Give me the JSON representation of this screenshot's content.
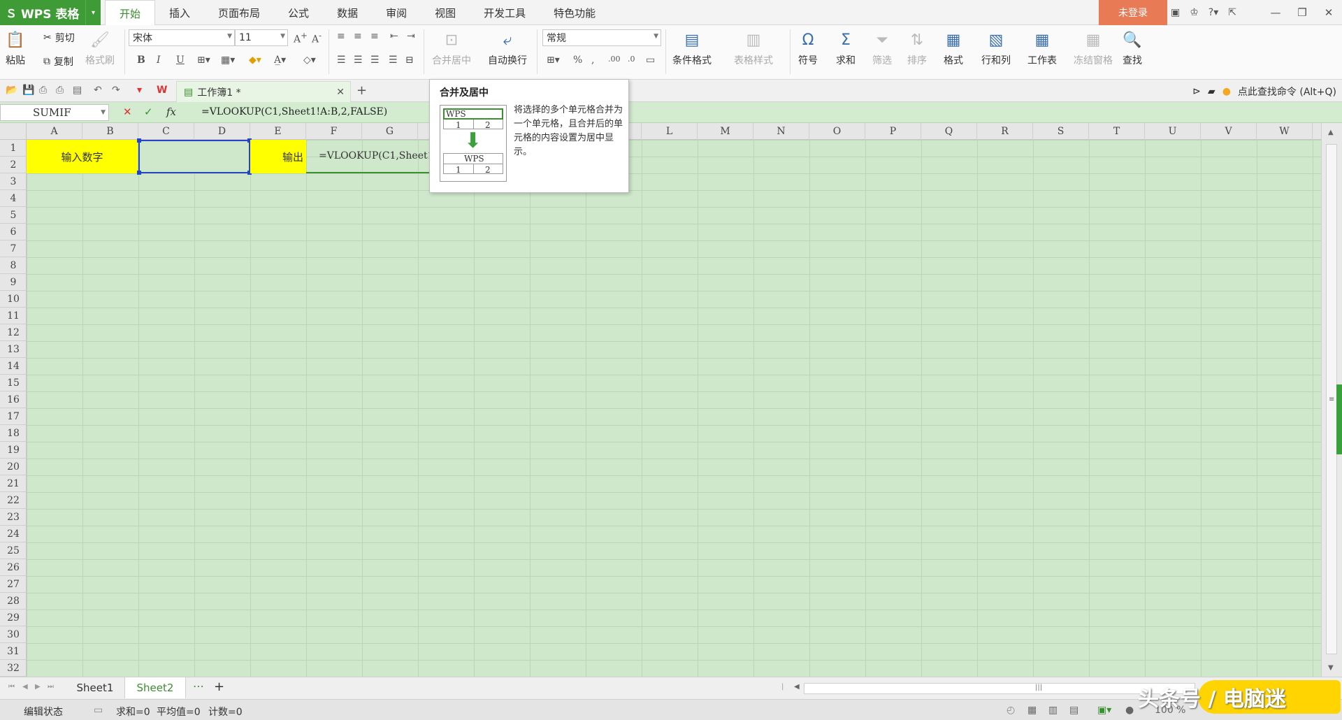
{
  "app": {
    "name": "WPS 表格",
    "login": "未登录"
  },
  "menu_tabs": [
    "开始",
    "插入",
    "页面布局",
    "公式",
    "数据",
    "审阅",
    "视图",
    "开发工具",
    "特色功能"
  ],
  "ribbon": {
    "paste": "粘贴",
    "cut": "剪切",
    "copy": "复制",
    "format_painter": "格式刷",
    "font_name": "宋体",
    "font_size": "11",
    "bold": "B",
    "italic": "I",
    "underline": "U",
    "merge_center": "合并居中",
    "wrap_text": "自动换行",
    "number_format": "常规",
    "percent": "%",
    "cond_format": "条件格式",
    "table_style": "表格样式",
    "symbol": "符号",
    "sum": "求和",
    "filter": "筛选",
    "sort": "排序",
    "format": "格式",
    "rows_cols": "行和列",
    "worksheet": "工作表",
    "freeze": "冻结窗格",
    "find": "查找"
  },
  "doc_tab": {
    "title": "工作簿1 *"
  },
  "command_search": "点此查找命令 (Alt+Q)",
  "formula_bar": {
    "name_box": "SUMIF",
    "cancel": "✕",
    "confirm": "✓",
    "fx": "fx",
    "formula": "=VLOOKUP(C1,Sheet1!A:B,2,FALSE)"
  },
  "columns": [
    "A",
    "B",
    "C",
    "D",
    "E",
    "F",
    "G",
    "H",
    "I",
    "J",
    "K",
    "L",
    "M",
    "N",
    "O",
    "P",
    "Q",
    "R",
    "S",
    "T",
    "U",
    "V",
    "W"
  ],
  "rows": [
    "1",
    "2",
    "3",
    "4",
    "5",
    "6",
    "7",
    "8",
    "9",
    "10",
    "11",
    "12",
    "13",
    "14",
    "15",
    "16",
    "17",
    "18",
    "19",
    "20",
    "21",
    "22",
    "23",
    "24",
    "25",
    "26",
    "27",
    "28",
    "29",
    "30",
    "31",
    "32"
  ],
  "cells": {
    "a1": "输入数字",
    "c1": "",
    "e1": "输出",
    "f1": "=VLOOKUP(C1,Sheet1!A:B,2,FALSE)"
  },
  "tooltip": {
    "title": "合并及居中",
    "description": "将选择的多个单元格合并为一个单元格，且合并后的单元格的内容设置为居中显示。",
    "sample_text": "WPS",
    "sample_cell_1": "1",
    "sample_cell_2": "2"
  },
  "sheets": [
    "Sheet1",
    "Sheet2"
  ],
  "active_sheet": "Sheet2",
  "status": {
    "mode": "编辑状态",
    "sum": "求和=0",
    "average": "平均值=0",
    "count": "计数=0",
    "zoom": "100 %"
  },
  "watermark": "头条号 / 电脑迷",
  "colors": {
    "accent_green": "#3f9b35",
    "cell_highlight": "#ffff00",
    "grid_bg": "#cfe8cc",
    "selection": "#2545c8",
    "login_btn": "#e87a55"
  }
}
